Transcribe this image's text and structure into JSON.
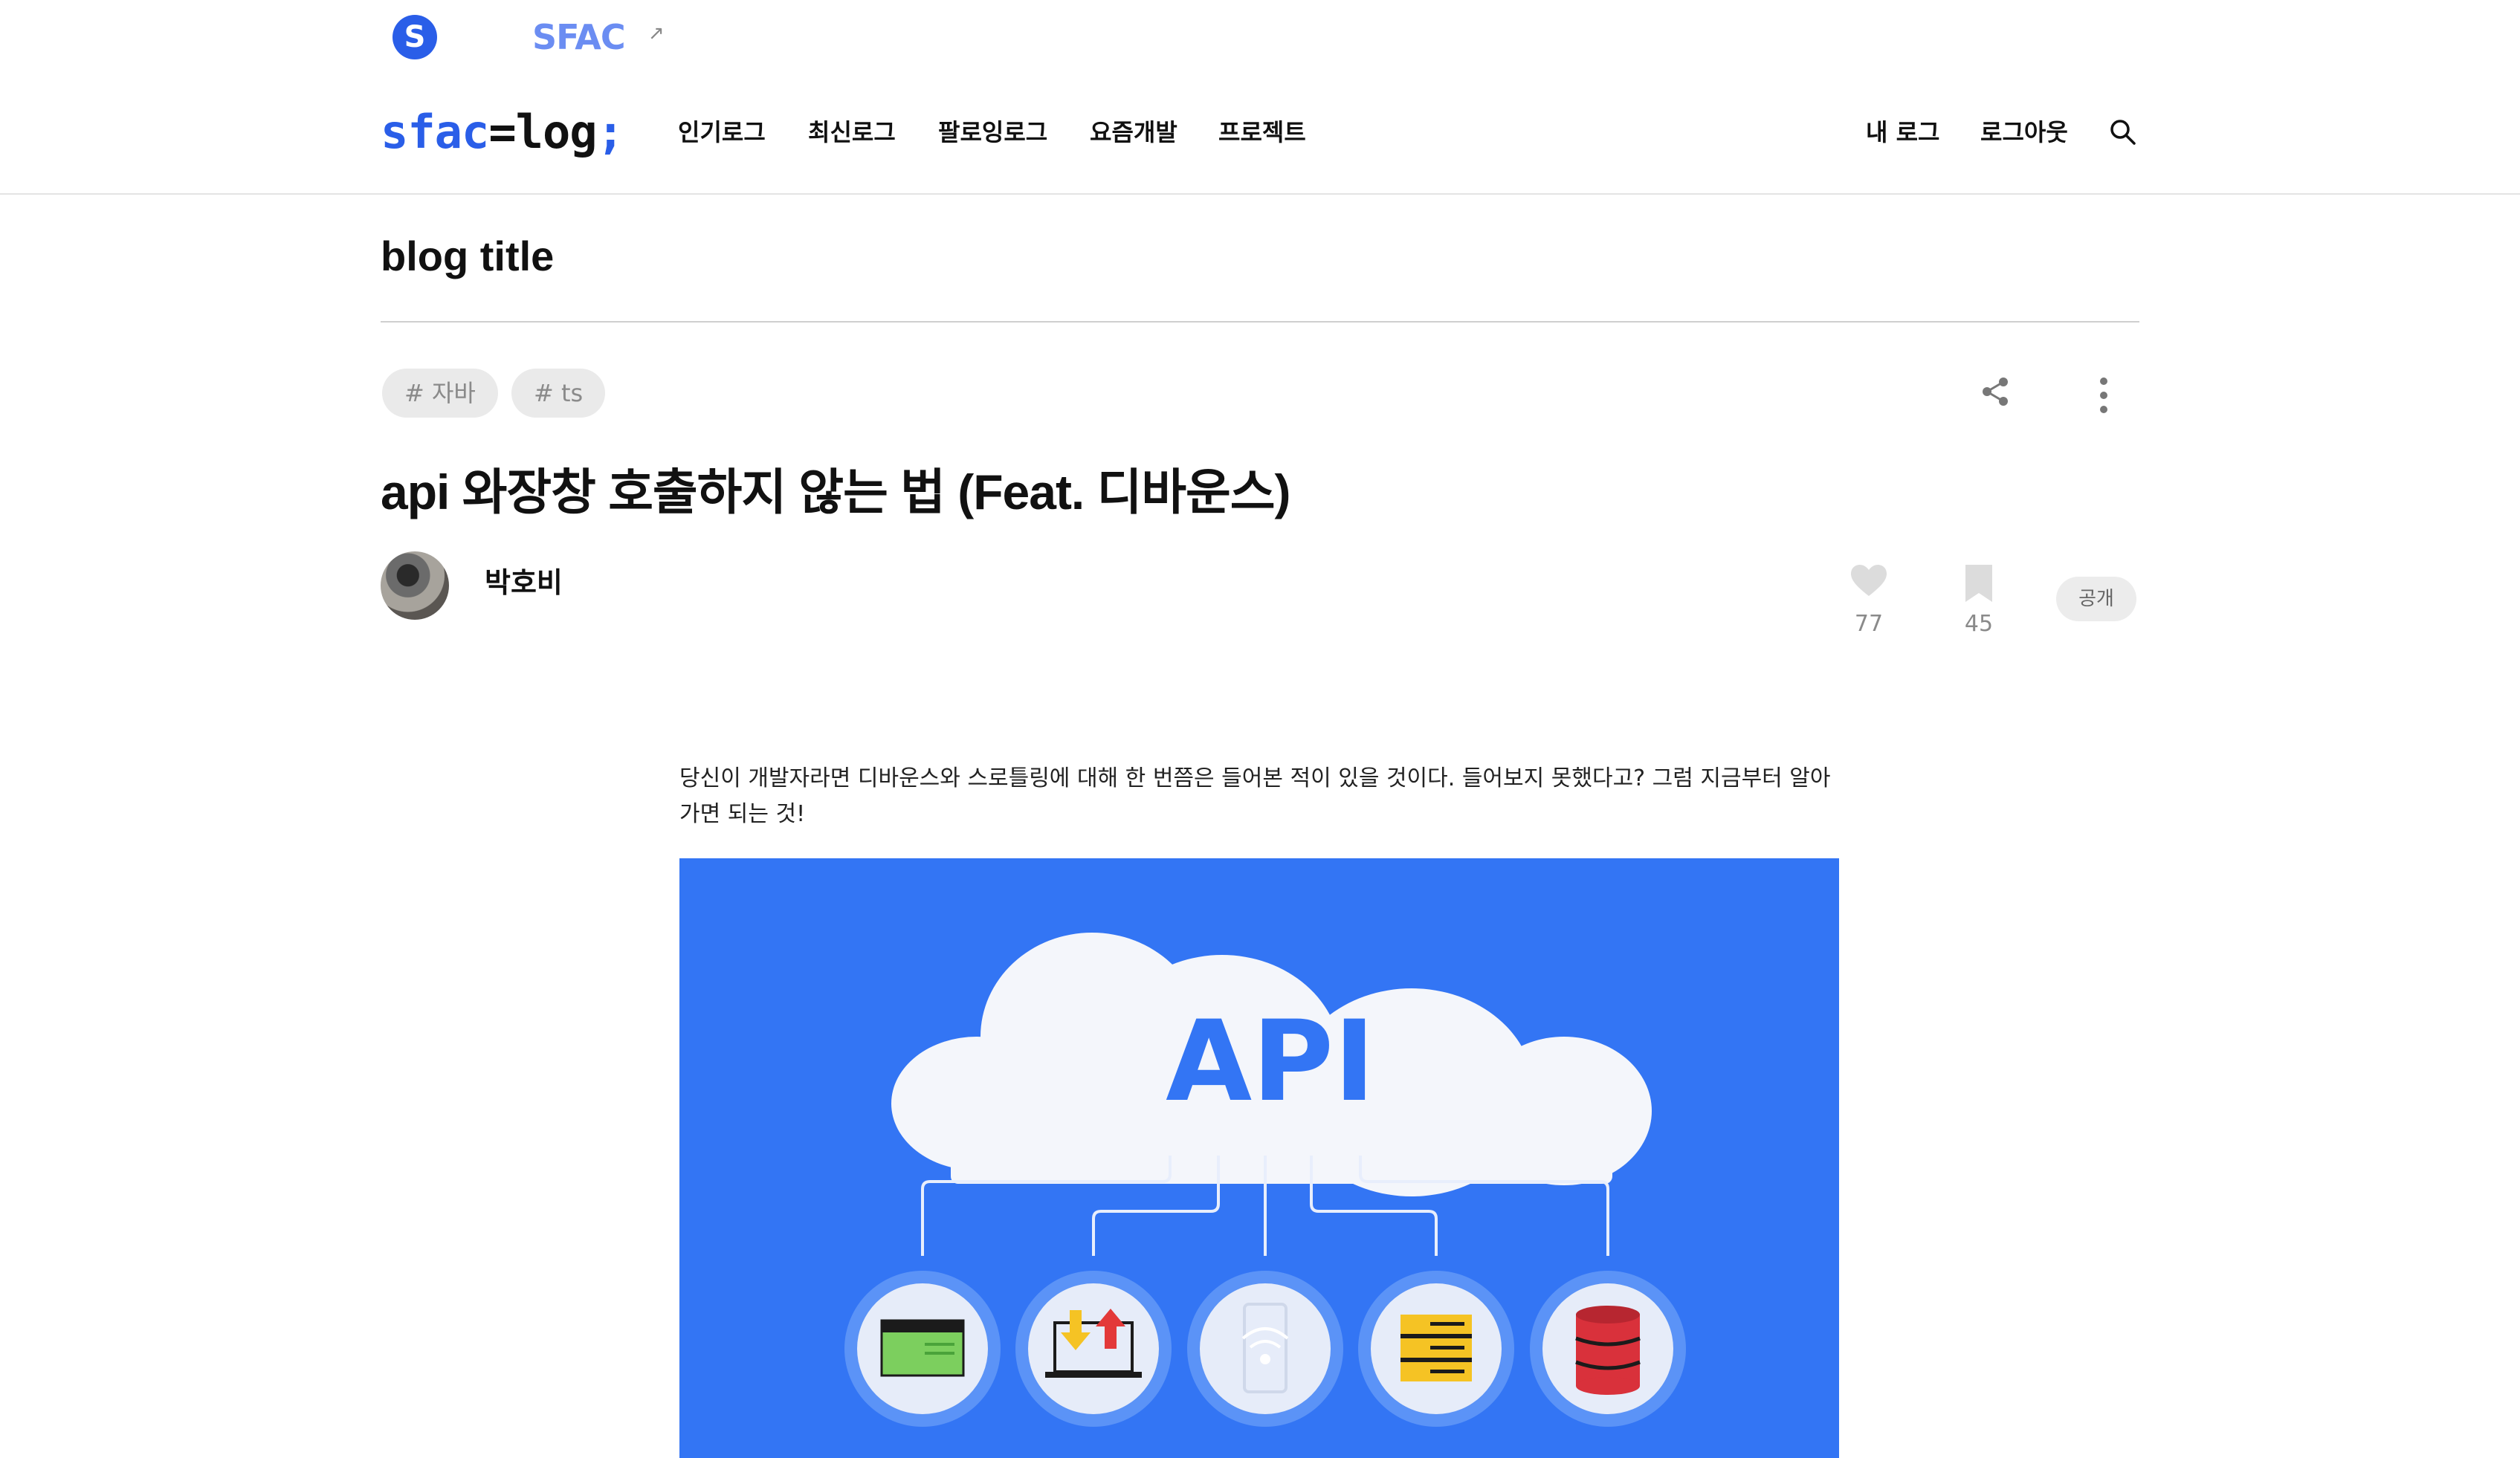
{
  "header": {
    "top_logo_letter": "S",
    "top_brand": "SFAC",
    "top_brand_arrow": "↗",
    "brand_part1": "sfac",
    "brand_part2": "=log",
    "brand_part3": ";",
    "nav": [
      "인기로그",
      "최신로그",
      "팔로잉로그",
      "요즘개발",
      "프로젝트"
    ],
    "my_log": "내 로그",
    "logout": "로그아웃"
  },
  "blog_title": "blog title",
  "post": {
    "tags": [
      "# 자바",
      "# ts"
    ],
    "title": "api 와장창 호출하지 않는 법 (Feat. 디바운스)",
    "author": "박호비",
    "likes": "77",
    "bookmarks": "45",
    "visibility": "공개",
    "intro": "당신이 개발자라면 디바운스와 스로틀링에 대해 한 번쯤은 들어본 적이 있을 것이다. 들어보지 못했다고? 그럼 지금부터 알아가면 되는 것!",
    "image_text": "API"
  },
  "colors": {
    "accent": "#2a5ee8",
    "image_bg": "#3375f4",
    "tag_bg": "#eaeaea"
  },
  "icons": [
    "s-logo-icon",
    "external-link-icon",
    "search-icon",
    "share-icon",
    "more-vertical-icon",
    "heart-icon",
    "bookmark-icon"
  ]
}
